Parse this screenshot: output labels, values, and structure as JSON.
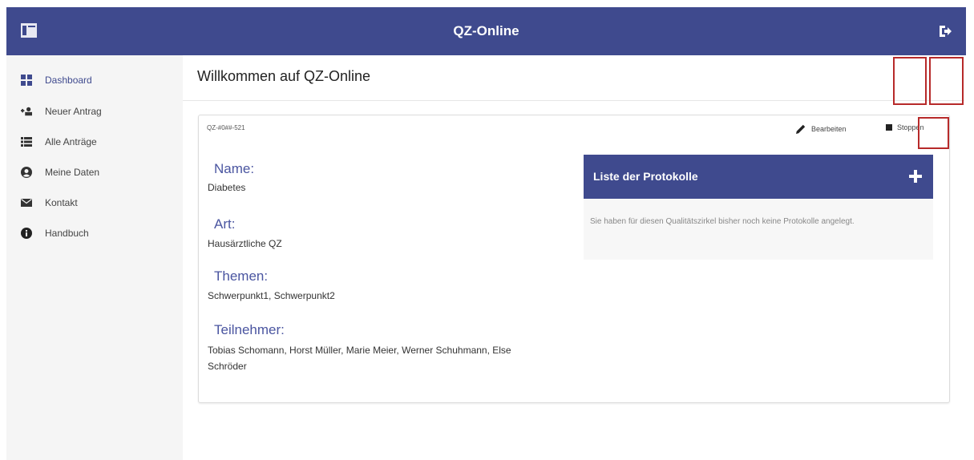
{
  "app": {
    "title": "QZ-Online"
  },
  "topbar": {
    "menu_icon": "sidebar-toggle-icon",
    "logout_icon": "logout-icon"
  },
  "sidebar": {
    "items": [
      {
        "label": "Dashboard",
        "icon": "dashboard-icon",
        "active": true
      },
      {
        "label": "Neuer Antrag",
        "icon": "new-request-icon",
        "active": false
      },
      {
        "label": "Alle Anträge",
        "icon": "list-icon",
        "active": false
      },
      {
        "label": "Meine Daten",
        "icon": "user-circle-icon",
        "active": false
      },
      {
        "label": "Kontakt",
        "icon": "envelope-icon",
        "active": false
      },
      {
        "label": "Handbuch",
        "icon": "info-icon",
        "active": false
      }
    ]
  },
  "main": {
    "title": "Willkommen auf QZ-Online",
    "card": {
      "id": "QZ-#0##-521",
      "edit_label": "Bearbeiten",
      "stop_label": "Stoppen",
      "fields": [
        {
          "label": "Name:",
          "value": "Diabetes"
        },
        {
          "label": "Art:",
          "value": "Hausärztliche QZ"
        },
        {
          "label": "Themen:",
          "value": "Schwerpunkt1, Schwerpunkt2"
        },
        {
          "label": "Teilnehmer:",
          "value": "Tobias Schomann, Horst Müller, Marie Meier, Werner Schuhmann, Else Schröder"
        }
      ],
      "protokolle": {
        "title": "Liste der Protokolle",
        "empty_text": "Sie haben für diesen Qualitätszirkel bisher noch keine Protokolle angelegt."
      }
    }
  },
  "colors": {
    "primary": "#3f4a8e",
    "accent_text": "#4a55a0",
    "highlight_box": "#b72a2a"
  }
}
